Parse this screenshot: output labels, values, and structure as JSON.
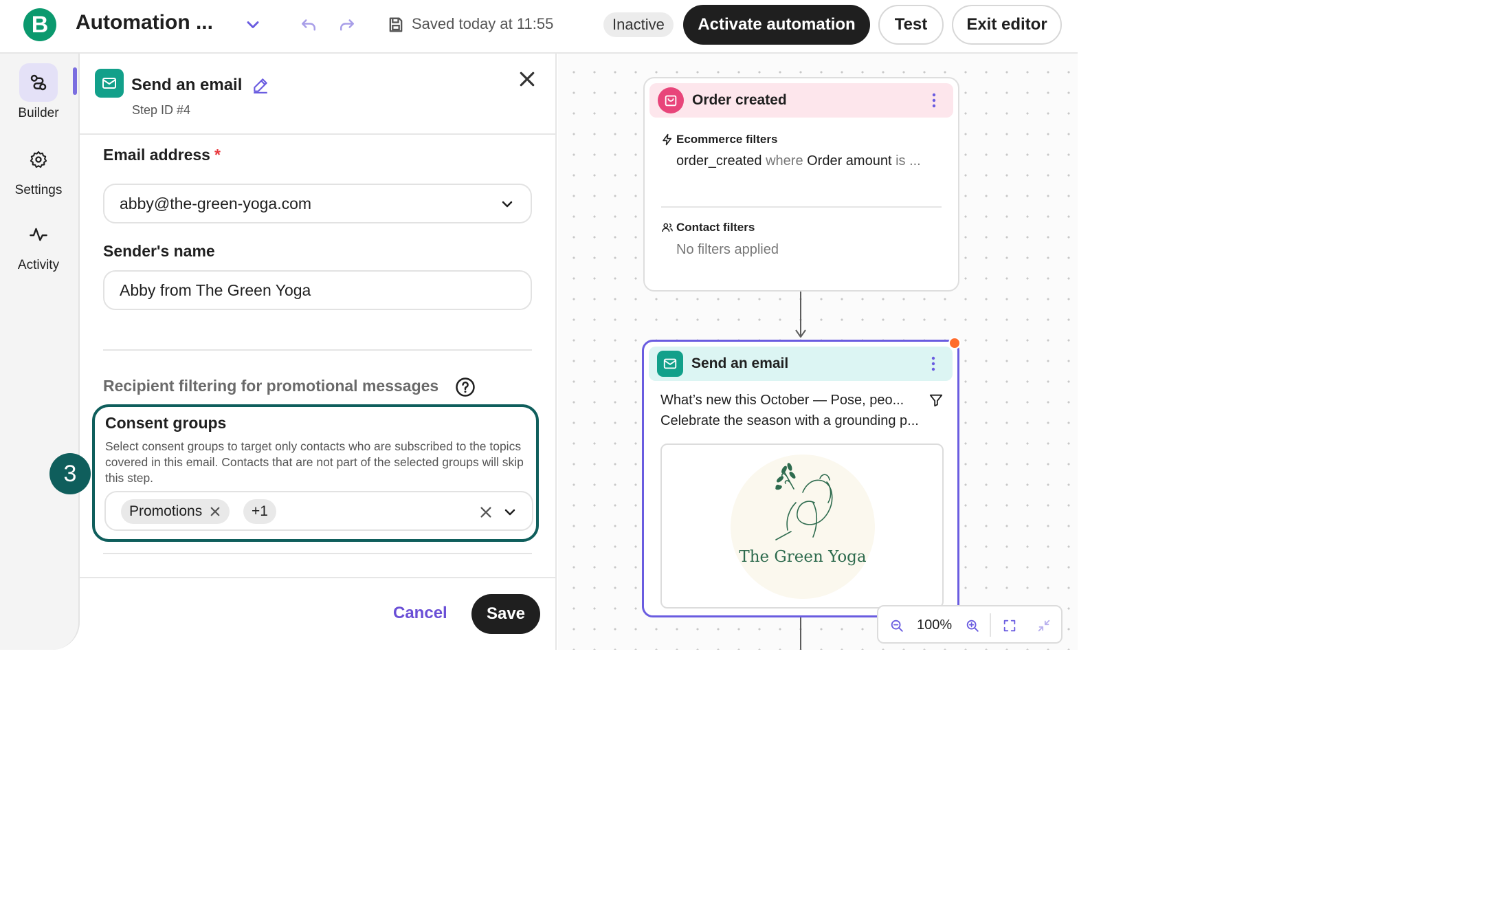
{
  "header": {
    "logo_letter": "B",
    "title": "Automation ...",
    "saved_text": "Saved today at 11:55",
    "status_badge": "Inactive",
    "activate_label": "Activate automation",
    "test_label": "Test",
    "exit_label": "Exit editor"
  },
  "sidebar": {
    "items": [
      {
        "label": "Builder",
        "icon": "builder-icon"
      },
      {
        "label": "Settings",
        "icon": "gear-icon"
      },
      {
        "label": "Activity",
        "icon": "activity-icon"
      }
    ]
  },
  "panel": {
    "title": "Send an email",
    "step_id": "Step ID #4",
    "email_label": "Email address",
    "required_mark": "*",
    "email_value": "abby@the-green-yoga.com",
    "sender_label": "Sender's name",
    "sender_value": "Abby from The Green Yoga",
    "section_title": "Recipient filtering for promotional messages",
    "consent_title": "Consent groups",
    "consent_desc": "Select consent groups to target only contacts who are subscribed to the topics covered in this email. Contacts that are not part of the selected groups will skip this step.",
    "tags": [
      "Promotions"
    ],
    "more_tags": "+1",
    "step_badge": "3",
    "cancel_label": "Cancel",
    "save_label": "Save"
  },
  "canvas": {
    "order_node": {
      "title": "Order created",
      "ecommerce_title": "Ecommerce filters",
      "ecommerce_a": "order_created",
      "ecommerce_b": " where ",
      "ecommerce_c": "Order amount",
      "ecommerce_d": " is ...",
      "contact_title": "Contact filters",
      "contact_text": "No filters applied"
    },
    "email_node": {
      "title": "Send an email",
      "subject": "What’s new this October — Pose, peo...",
      "preheader": "Celebrate the season with a grounding p...",
      "preview_logo_text": "The Green Yoga"
    },
    "zoom_level": "100%"
  },
  "colors": {
    "brand_green": "#0b996e",
    "accent_purple": "#6a5ce0",
    "consent_border": "#0f5e5c",
    "teal_icon": "#12a08a",
    "pink_icon": "#e8457a",
    "orange_dot": "#ff6b2c"
  }
}
